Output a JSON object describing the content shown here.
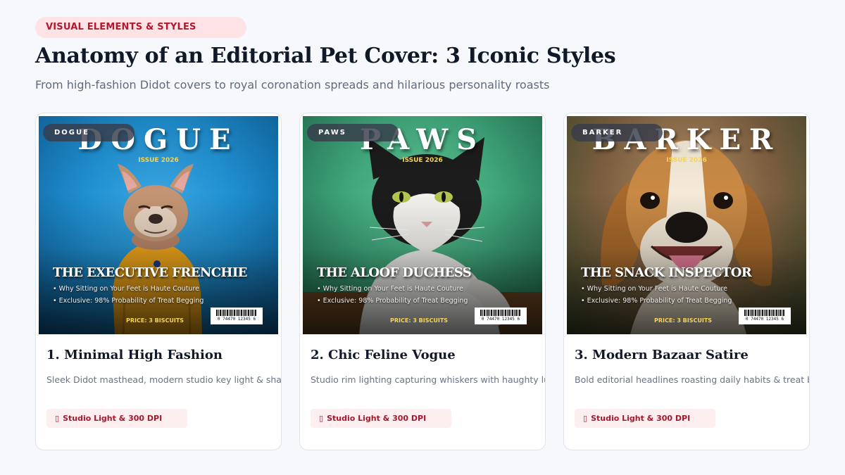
{
  "header": {
    "badge": "VISUAL ELEMENTS & STYLES",
    "title": "Anatomy of an Editorial Pet Cover: 3 Iconic Styles",
    "subtitle": "From high-fashion Didot covers to royal coronation spreads and hilarious personality roasts"
  },
  "cover_common": {
    "issue": "ISSUE 2026",
    "bullet_1": "• Why Sitting on Your Feet is Haute Couture",
    "bullet_2": "• Exclusive: 98% Probability of Treat Begging",
    "price": "PRICE: 3 BISCUITS",
    "barcode_number": "0 74470 12345 6"
  },
  "cards": [
    {
      "tag": "DOGUE",
      "masthead": "DOGUE",
      "headline": "THE EXECUTIVE FRENCHIE",
      "title": "1. Minimal High Fashion",
      "description": "Sleek Didot masthead, modern studio key light & sharp contrast",
      "chip": "Studio Light & 300 DPI",
      "chip_icon": "lightbulb-icon",
      "pet": "french-bulldog"
    },
    {
      "tag": "PAWS",
      "masthead": "PAWS",
      "headline": "THE ALOOF DUCHESS",
      "title": "2. Chic Feline Vogue",
      "description": "Studio rim lighting capturing whiskers with haughty luxury",
      "chip": "Studio Light & 300 DPI",
      "chip_icon": "lightbulb-icon",
      "pet": "tuxedo-cat"
    },
    {
      "tag": "BARKER",
      "masthead": "BARKER",
      "headline": "THE SNACK INSPECTOR",
      "title": "3. Modern Bazaar Satire",
      "description": "Bold editorial headlines roasting daily habits & treat begging",
      "chip": "Studio Light & 300 DPI",
      "chip_icon": "lightbulb-icon",
      "pet": "beagle"
    }
  ],
  "colors": {
    "badge_bg": "#fde3e5",
    "badge_text": "#b3182f",
    "cover1_bg": "#1f8fd0",
    "cover2_bg": "#3fa67a",
    "cover3_bg": "#8a6a4a",
    "issue_gold": "#f3d35a"
  }
}
